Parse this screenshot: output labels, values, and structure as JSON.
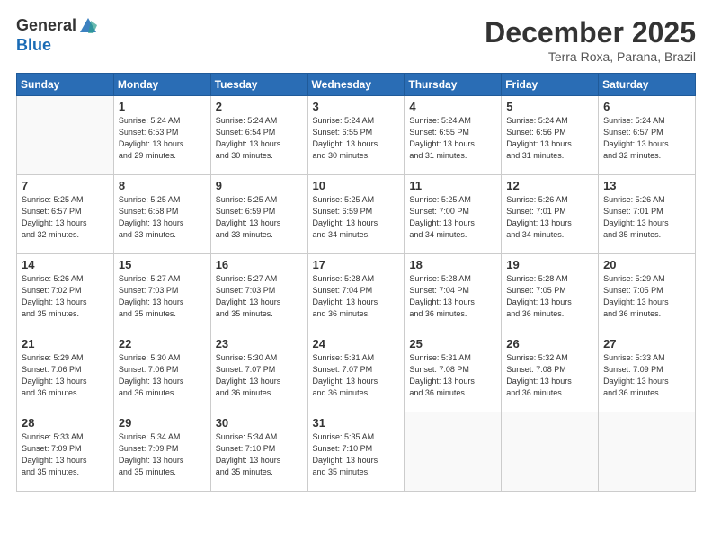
{
  "header": {
    "logo_line1": "General",
    "logo_line2": "Blue",
    "month": "December 2025",
    "location": "Terra Roxa, Parana, Brazil"
  },
  "days_of_week": [
    "Sunday",
    "Monday",
    "Tuesday",
    "Wednesday",
    "Thursday",
    "Friday",
    "Saturday"
  ],
  "weeks": [
    [
      {
        "day": "",
        "info": ""
      },
      {
        "day": "1",
        "info": "Sunrise: 5:24 AM\nSunset: 6:53 PM\nDaylight: 13 hours\nand 29 minutes."
      },
      {
        "day": "2",
        "info": "Sunrise: 5:24 AM\nSunset: 6:54 PM\nDaylight: 13 hours\nand 30 minutes."
      },
      {
        "day": "3",
        "info": "Sunrise: 5:24 AM\nSunset: 6:55 PM\nDaylight: 13 hours\nand 30 minutes."
      },
      {
        "day": "4",
        "info": "Sunrise: 5:24 AM\nSunset: 6:55 PM\nDaylight: 13 hours\nand 31 minutes."
      },
      {
        "day": "5",
        "info": "Sunrise: 5:24 AM\nSunset: 6:56 PM\nDaylight: 13 hours\nand 31 minutes."
      },
      {
        "day": "6",
        "info": "Sunrise: 5:24 AM\nSunset: 6:57 PM\nDaylight: 13 hours\nand 32 minutes."
      }
    ],
    [
      {
        "day": "7",
        "info": "Sunrise: 5:25 AM\nSunset: 6:57 PM\nDaylight: 13 hours\nand 32 minutes."
      },
      {
        "day": "8",
        "info": "Sunrise: 5:25 AM\nSunset: 6:58 PM\nDaylight: 13 hours\nand 33 minutes."
      },
      {
        "day": "9",
        "info": "Sunrise: 5:25 AM\nSunset: 6:59 PM\nDaylight: 13 hours\nand 33 minutes."
      },
      {
        "day": "10",
        "info": "Sunrise: 5:25 AM\nSunset: 6:59 PM\nDaylight: 13 hours\nand 34 minutes."
      },
      {
        "day": "11",
        "info": "Sunrise: 5:25 AM\nSunset: 7:00 PM\nDaylight: 13 hours\nand 34 minutes."
      },
      {
        "day": "12",
        "info": "Sunrise: 5:26 AM\nSunset: 7:01 PM\nDaylight: 13 hours\nand 34 minutes."
      },
      {
        "day": "13",
        "info": "Sunrise: 5:26 AM\nSunset: 7:01 PM\nDaylight: 13 hours\nand 35 minutes."
      }
    ],
    [
      {
        "day": "14",
        "info": "Sunrise: 5:26 AM\nSunset: 7:02 PM\nDaylight: 13 hours\nand 35 minutes."
      },
      {
        "day": "15",
        "info": "Sunrise: 5:27 AM\nSunset: 7:03 PM\nDaylight: 13 hours\nand 35 minutes."
      },
      {
        "day": "16",
        "info": "Sunrise: 5:27 AM\nSunset: 7:03 PM\nDaylight: 13 hours\nand 35 minutes."
      },
      {
        "day": "17",
        "info": "Sunrise: 5:28 AM\nSunset: 7:04 PM\nDaylight: 13 hours\nand 36 minutes."
      },
      {
        "day": "18",
        "info": "Sunrise: 5:28 AM\nSunset: 7:04 PM\nDaylight: 13 hours\nand 36 minutes."
      },
      {
        "day": "19",
        "info": "Sunrise: 5:28 AM\nSunset: 7:05 PM\nDaylight: 13 hours\nand 36 minutes."
      },
      {
        "day": "20",
        "info": "Sunrise: 5:29 AM\nSunset: 7:05 PM\nDaylight: 13 hours\nand 36 minutes."
      }
    ],
    [
      {
        "day": "21",
        "info": "Sunrise: 5:29 AM\nSunset: 7:06 PM\nDaylight: 13 hours\nand 36 minutes."
      },
      {
        "day": "22",
        "info": "Sunrise: 5:30 AM\nSunset: 7:06 PM\nDaylight: 13 hours\nand 36 minutes."
      },
      {
        "day": "23",
        "info": "Sunrise: 5:30 AM\nSunset: 7:07 PM\nDaylight: 13 hours\nand 36 minutes."
      },
      {
        "day": "24",
        "info": "Sunrise: 5:31 AM\nSunset: 7:07 PM\nDaylight: 13 hours\nand 36 minutes."
      },
      {
        "day": "25",
        "info": "Sunrise: 5:31 AM\nSunset: 7:08 PM\nDaylight: 13 hours\nand 36 minutes."
      },
      {
        "day": "26",
        "info": "Sunrise: 5:32 AM\nSunset: 7:08 PM\nDaylight: 13 hours\nand 36 minutes."
      },
      {
        "day": "27",
        "info": "Sunrise: 5:33 AM\nSunset: 7:09 PM\nDaylight: 13 hours\nand 36 minutes."
      }
    ],
    [
      {
        "day": "28",
        "info": "Sunrise: 5:33 AM\nSunset: 7:09 PM\nDaylight: 13 hours\nand 35 minutes."
      },
      {
        "day": "29",
        "info": "Sunrise: 5:34 AM\nSunset: 7:09 PM\nDaylight: 13 hours\nand 35 minutes."
      },
      {
        "day": "30",
        "info": "Sunrise: 5:34 AM\nSunset: 7:10 PM\nDaylight: 13 hours\nand 35 minutes."
      },
      {
        "day": "31",
        "info": "Sunrise: 5:35 AM\nSunset: 7:10 PM\nDaylight: 13 hours\nand 35 minutes."
      },
      {
        "day": "",
        "info": ""
      },
      {
        "day": "",
        "info": ""
      },
      {
        "day": "",
        "info": ""
      }
    ]
  ]
}
